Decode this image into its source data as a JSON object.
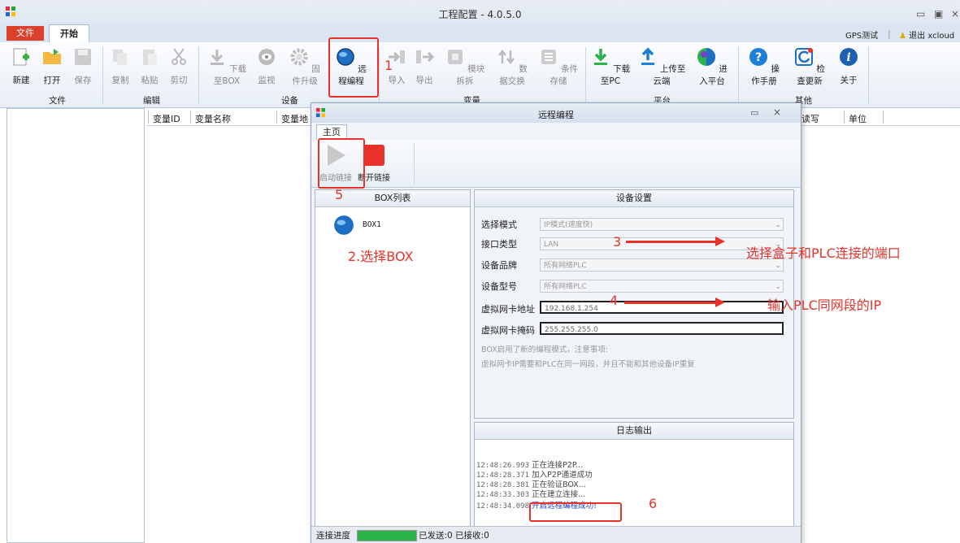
{
  "window": {
    "title": "工程配置 - 4.0.5.0"
  },
  "menu": {
    "file_tab": "文件",
    "start_tab": "开始",
    "gps_test": "GPS测试",
    "logout": "退出 xcloud"
  },
  "ribbon": {
    "groups": [
      {
        "label": "文件",
        "buttons": [
          "新建",
          "打开",
          "保存"
        ]
      },
      {
        "label": "编辑",
        "buttons": [
          "复制",
          "粘贴",
          "剪切"
        ]
      },
      {
        "label": "设备",
        "buttons": [
          "下载至BOX",
          "监视",
          "固件升级",
          "远程编程"
        ]
      },
      {
        "label": "变量",
        "buttons": [
          "导入",
          "导出",
          "模块拆拆",
          "数据交换",
          "条件存储"
        ]
      },
      {
        "label": "平台",
        "buttons": [
          "下载至PC",
          "上传至云端",
          "进入平台"
        ]
      },
      {
        "label": "其他",
        "buttons": [
          "操作手册",
          "检查更新",
          "关于"
        ]
      }
    ]
  },
  "grid": {
    "columns": [
      "变量ID",
      "变量名称",
      "变量地",
      "读写",
      "单位"
    ]
  },
  "dialog": {
    "title": "远程编程",
    "tab": "主页",
    "start_link": "启动链接",
    "stop_link": "断开链接",
    "box_list_title": "BOX列表",
    "box_item": "BOX1",
    "settings_title": "设备设置",
    "fields": [
      {
        "label": "选择模式",
        "value": "IP模式(速度快)"
      },
      {
        "label": "接口类型",
        "value": "LAN"
      },
      {
        "label": "设备品牌",
        "value": "所有网络PLC"
      },
      {
        "label": "设备型号",
        "value": "所有网络PLC"
      },
      {
        "label": "虚拟网卡地址",
        "value": "192.168.1.254"
      },
      {
        "label": "虚拟网卡掩码",
        "value": "255.255.255.0"
      }
    ],
    "note1": "BOX启用了新的编程模式，注意事项:",
    "note2": "虚拟网卡IP需要和PLC在同一网段，并且不能和其他设备IP重复",
    "log_title": "日志输出",
    "log": [
      {
        "time": "12:48:26.993",
        "msg": "正在连接P2P..."
      },
      {
        "time": "12:48:28.371",
        "msg": "加入P2P通道成功"
      },
      {
        "time": "12:48:28.381",
        "msg": "正在验证BOX..."
      },
      {
        "time": "12:48:33.303",
        "msg": "正在建立连接..."
      },
      {
        "time": "12:48:34.098",
        "msg": "开启远程编程成功!"
      }
    ],
    "status_label": "连接进度",
    "progress": 1.0,
    "sent_recv": "已发送:0 已接收:0"
  },
  "annotations": {
    "n1": "1",
    "n2": "2.选择BOX",
    "n3": "3",
    "n3_text": "选择盒子和PLC连接的端口",
    "n4": "4",
    "n4_text": "输入PLC同网段的IP",
    "n5": "5",
    "n6": "6"
  },
  "colors": {
    "accent_red": "#e8322a",
    "progress_green": "#2bb34a",
    "file_tab": "#d9412d"
  }
}
